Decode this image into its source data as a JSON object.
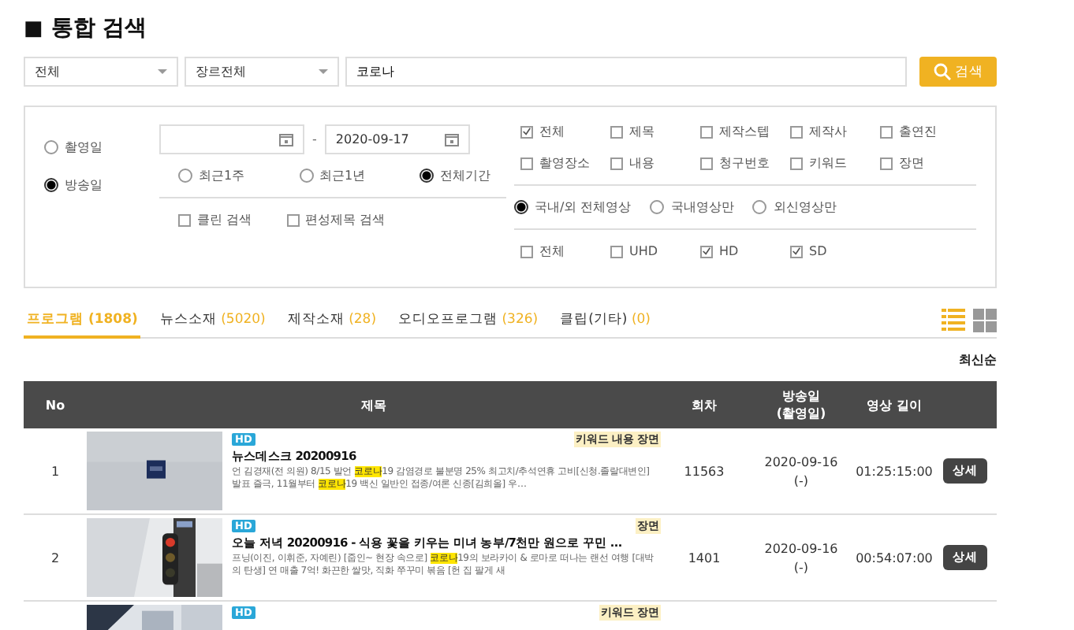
{
  "page_title": {
    "icon": "■",
    "text": "통합 검색"
  },
  "search": {
    "category": "전체",
    "genre": "장르전체",
    "query": "코로나",
    "button": "검색"
  },
  "date_type": [
    {
      "label": "촬영일",
      "selected": false
    },
    {
      "label": "방송일",
      "selected": true
    }
  ],
  "date_range": {
    "separator": "-",
    "to": "2020-09-17"
  },
  "periods": [
    {
      "label": "최근1주",
      "selected": false
    },
    {
      "label": "최근1년",
      "selected": false
    },
    {
      "label": "전체기간",
      "selected": true
    }
  ],
  "options": [
    {
      "label": "클린 검색",
      "checked": false
    },
    {
      "label": "편성제목 검색",
      "checked": false
    }
  ],
  "fields": [
    {
      "label": "전체",
      "checked": true
    },
    {
      "label": "제목",
      "checked": false
    },
    {
      "label": "제작스텝",
      "checked": false
    },
    {
      "label": "제작사",
      "checked": false
    },
    {
      "label": "출연진",
      "checked": false
    },
    {
      "label": "촬영장소",
      "checked": false
    },
    {
      "label": "내용",
      "checked": false
    },
    {
      "label": "청구번호",
      "checked": false
    },
    {
      "label": "키워드",
      "checked": false
    },
    {
      "label": "장면",
      "checked": false
    }
  ],
  "scope": [
    {
      "label": "국내/외 전체영상",
      "selected": true
    },
    {
      "label": "국내영상만",
      "selected": false
    },
    {
      "label": "외신영상만",
      "selected": false
    }
  ],
  "quality": [
    {
      "label": "전체",
      "checked": false
    },
    {
      "label": "UHD",
      "checked": false
    },
    {
      "label": "HD",
      "checked": true
    },
    {
      "label": "SD",
      "checked": true
    }
  ],
  "tabs": [
    {
      "label": "프로그램",
      "count": "(1808)",
      "selected": true
    },
    {
      "label": "뉴스소재",
      "count": "(5020)",
      "selected": false
    },
    {
      "label": "제작소재",
      "count": "(28)",
      "selected": false
    },
    {
      "label": "오디오프로그램",
      "count": "(326)",
      "selected": false
    },
    {
      "label": "클립(기타)",
      "count": "(0)",
      "selected": false
    }
  ],
  "view_modes": [
    {
      "kind": "list",
      "selected": true
    },
    {
      "kind": "grid",
      "selected": false
    }
  ],
  "sort": "최신순",
  "table": {
    "columns": [
      "No",
      "제목",
      "회차",
      "방송일\n(촬영일)",
      "영상 길이"
    ],
    "rows": [
      {
        "no": "1",
        "badge": "HD",
        "tags": [
          "키워드",
          "내용",
          "장면"
        ],
        "title": "뉴스데스크 20200916",
        "description": [
          {
            "text": "언 김경재(전 의원) 8/15 발언 ",
            "highlight": false
          },
          {
            "text": "코로나",
            "highlight": true
          },
          {
            "text": "19 감염경로 불분명 25% 최고치/추석연휴 고비[신청.졸랄대변인] 발표 즐극, 11월부터 ",
            "highlight": false
          },
          {
            "text": "코로나",
            "highlight": true
          },
          {
            "text": "19 백신 일반인 접종/여론 신종[김희올] 우…",
            "highlight": false
          }
        ],
        "episode": "11563",
        "date": "2020-09-16",
        "date2": "(-)",
        "duration": "01:25:15:00",
        "button": "상세",
        "thumb": {
          "kind": "picture"
        }
      },
      {
        "no": "2",
        "badge": "HD",
        "tags": [
          "장면"
        ],
        "title": "오늘 저녁 20200916 - 식용 꽃을 키우는 미녀 농부/7천만 원으로 꾸민 …",
        "description": [
          {
            "text": "프닝(이진, 이휘준, 자예린) [줍인~ 현장 속으로] ",
            "highlight": false
          },
          {
            "text": "코로나",
            "highlight": true
          },
          {
            "text": "19의 보라카이 & 로마로 떠나는 랜선 여행 [대박의 탄생] 연 매출 7억! 화끈한 쌀맛, 직화 쭈꾸미 볶음 [헌 집 팔게 새",
            "highlight": false
          }
        ],
        "episode": "1401",
        "date": "2020-09-16",
        "date2": "(-)",
        "duration": "00:54:07:00",
        "button": "상세",
        "thumb": {
          "kind": "picture"
        }
      },
      {
        "badge": "HD",
        "tags": [
          "키워드",
          "장면"
        ],
        "thumb": {
          "kind": "picture"
        }
      }
    ]
  }
}
